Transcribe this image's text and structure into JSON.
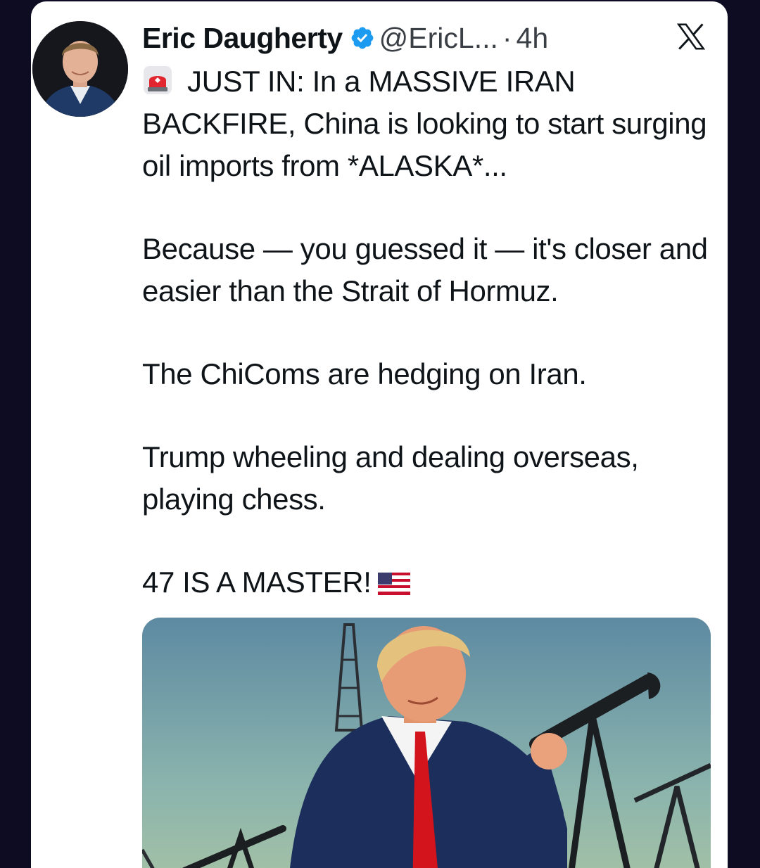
{
  "tweet": {
    "author_name": "Eric Daugherty",
    "handle": "@EricL...",
    "separator": "·",
    "time": "4h",
    "line1": "JUST IN: In a MASSIVE IRAN BACKFIRE, China is looking to start surging oil imports from *ALASKA*...",
    "para2": "Because — you guessed it — it's closer and easier than the Strait of Hormuz.",
    "para3": "The ChiComs are hedging on Iran.",
    "para4": "Trump wheeling and dealing overseas, playing chess.",
    "para5": "47 IS A MASTER!"
  },
  "icons": {
    "verified": "verified-badge-icon",
    "platform": "x-logo-icon",
    "siren": "rotating-light-icon",
    "flag": "us-flag-icon"
  },
  "colors": {
    "background": "#0e0c22",
    "card": "#ffffff",
    "verified_blue": "#1d9bf0",
    "text": "#0f1419",
    "secondary_text": "#3a3f45"
  }
}
